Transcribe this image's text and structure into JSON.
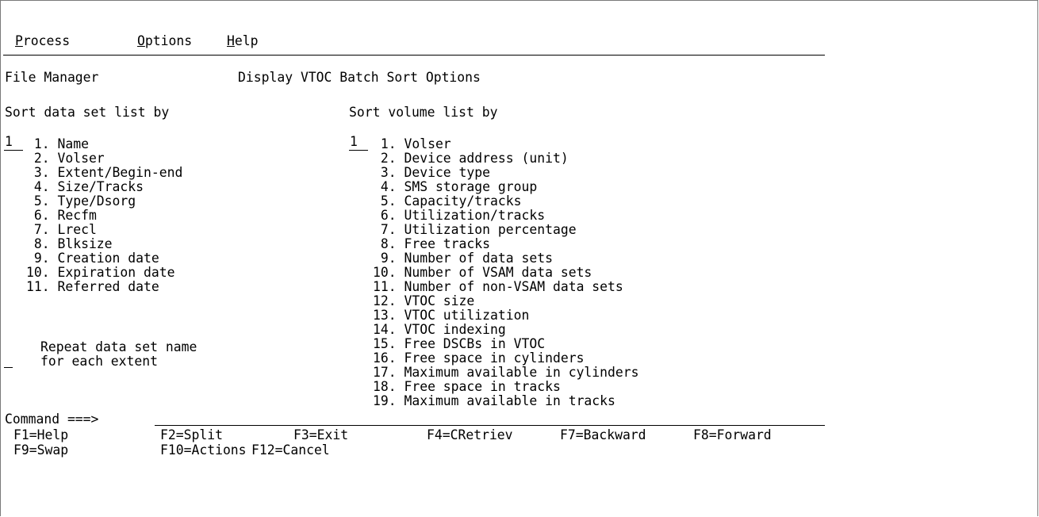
{
  "menu": {
    "items": [
      {
        "hot": "P",
        "rest": "rocess"
      },
      {
        "hot": "O",
        "rest": "ptions"
      },
      {
        "hot": "H",
        "rest": "elp"
      }
    ]
  },
  "header": {
    "app": "File Manager",
    "title": "Display VTOC Batch Sort Options"
  },
  "dataset_sort": {
    "heading": "Sort data set list by",
    "value": "1",
    "options": [
      " 1. Name",
      " 2. Volser",
      " 3. Extent/Begin-end",
      " 4. Size/Tracks",
      " 5. Type/Dsorg",
      " 6. Recfm",
      " 7. Lrecl",
      " 8. Blksize",
      " 9. Creation date",
      "10. Expiration date",
      "11. Referred date"
    ],
    "repeat": {
      "value": "",
      "line1": "Repeat data set name",
      "line2": "for each extent"
    }
  },
  "volume_sort": {
    "heading": "Sort volume list by",
    "value": "1",
    "options": [
      " 1. Volser",
      " 2. Device address (unit)",
      " 3. Device type",
      " 4. SMS storage group",
      " 5. Capacity/tracks",
      " 6. Utilization/tracks",
      " 7. Utilization percentage",
      " 8. Free tracks",
      " 9. Number of data sets",
      "10. Number of VSAM data sets",
      "11. Number of non-VSAM data sets",
      "12. VTOC size",
      "13. VTOC utilization",
      "14. VTOC indexing",
      "15. Free DSCBs in VTOC",
      "16. Free space in cylinders",
      "17. Maximum available in cylinders",
      "18. Free space in tracks",
      "19. Maximum available in tracks"
    ]
  },
  "command": {
    "label": "Command ===>",
    "value": ""
  },
  "fkeys": {
    "row1": [
      "F1=Help",
      "F2=Split",
      "F3=Exit",
      "F4=CRetriev",
      "F7=Backward",
      "F8=Forward"
    ],
    "row2": [
      "F9=Swap",
      "F10=Actions",
      "F12=Cancel"
    ]
  }
}
